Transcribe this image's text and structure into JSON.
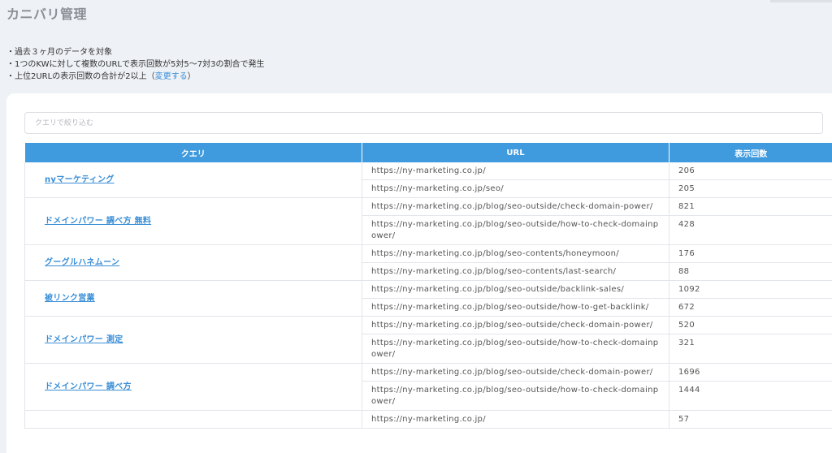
{
  "page": {
    "title": "カニバリ管理"
  },
  "notes": {
    "line1": "・過去３ヶ月のデータを対象",
    "line2": "・1つのKWに対して複数のURLで表示回数が5対5～7対3の割合で発生",
    "line3_prefix": "・上位2URLの表示回数の合計が2以上（",
    "line3_link": "変更する",
    "line3_suffix": "）"
  },
  "filter": {
    "placeholder": "クエリで絞り込む"
  },
  "table": {
    "headers": {
      "query": "クエリ",
      "url": "URL",
      "impressions": "表示回数"
    },
    "groups": [
      {
        "query": "nyマーケティング",
        "rows": [
          {
            "url": "https://ny-marketing.co.jp/",
            "count": "206"
          },
          {
            "url": "https://ny-marketing.co.jp/seo/",
            "count": "205"
          }
        ]
      },
      {
        "query": "ドメインパワー 調べ方 無料",
        "rows": [
          {
            "url": "https://ny-marketing.co.jp/blog/seo-outside/check-domain-power/",
            "count": "821"
          },
          {
            "url": "https://ny-marketing.co.jp/blog/seo-outside/how-to-check-domainpower/",
            "count": "428"
          }
        ]
      },
      {
        "query": "グーグルハネムーン",
        "rows": [
          {
            "url": "https://ny-marketing.co.jp/blog/seo-contents/honeymoon/",
            "count": "176"
          },
          {
            "url": "https://ny-marketing.co.jp/blog/seo-contents/last-search/",
            "count": "88"
          }
        ]
      },
      {
        "query": "被リンク営業",
        "rows": [
          {
            "url": "https://ny-marketing.co.jp/blog/seo-outside/backlink-sales/",
            "count": "1092"
          },
          {
            "url": "https://ny-marketing.co.jp/blog/seo-outside/how-to-get-backlink/",
            "count": "672"
          }
        ]
      },
      {
        "query": "ドメインパワー 測定",
        "rows": [
          {
            "url": "https://ny-marketing.co.jp/blog/seo-outside/check-domain-power/",
            "count": "520"
          },
          {
            "url": "https://ny-marketing.co.jp/blog/seo-outside/how-to-check-domainpower/",
            "count": "321"
          }
        ]
      },
      {
        "query": "ドメインパワー 調べ方",
        "rows": [
          {
            "url": "https://ny-marketing.co.jp/blog/seo-outside/check-domain-power/",
            "count": "1696"
          },
          {
            "url": "https://ny-marketing.co.jp/blog/seo-outside/how-to-check-domainpower/",
            "count": "1444"
          }
        ]
      },
      {
        "query": "",
        "rows": [
          {
            "url": "https://ny-marketing.co.jp/",
            "count": "57"
          }
        ]
      }
    ]
  }
}
